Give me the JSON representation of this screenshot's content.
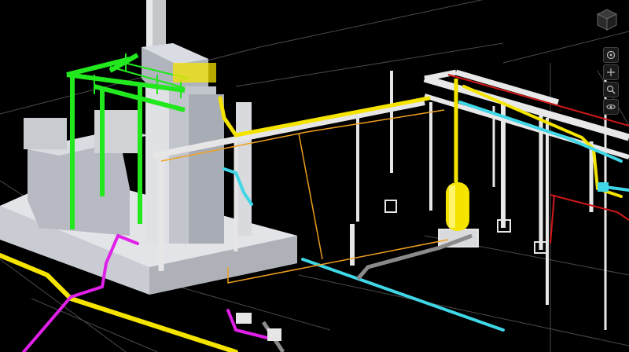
{
  "viewport": {
    "background": "#000000",
    "view_cube_icon": "view-cube-icon",
    "nav_tools": [
      {
        "name": "steering-wheel",
        "icon": "steering-wheel-icon"
      },
      {
        "name": "pan",
        "icon": "pan-icon"
      },
      {
        "name": "zoom",
        "icon": "zoom-icon"
      },
      {
        "name": "orbit",
        "icon": "orbit-icon"
      }
    ]
  },
  "scene": {
    "grid_line_color": "#4a4a4a",
    "steel_color": "#e6e6e6",
    "skid_color": "#d9dbe0",
    "platform_green": "#22e81e",
    "pipe_colors": {
      "yellow": "#f4e400",
      "cyan": "#3fd6e6",
      "magenta": "#e020e8",
      "orange": "#f0a020",
      "red": "#d01818",
      "grey": "#8a8a8a"
    }
  }
}
